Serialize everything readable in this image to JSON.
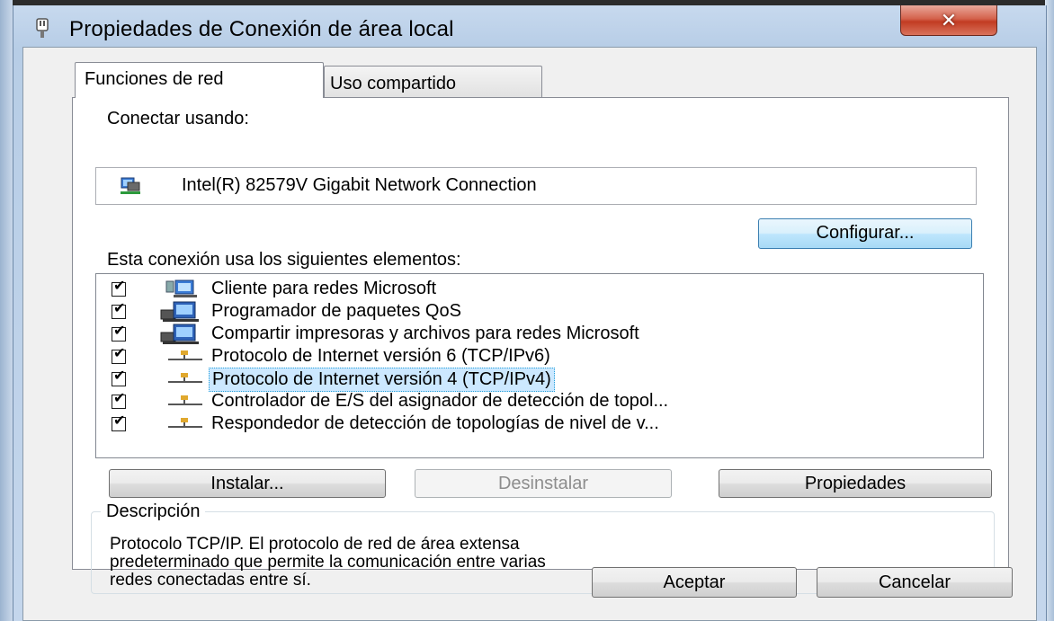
{
  "window": {
    "title": "Propiedades de Conexión de área local",
    "close_label": "✕"
  },
  "tabs": [
    {
      "label": "Funciones de red",
      "active": true
    },
    {
      "label": "Uso compartido",
      "active": false
    }
  ],
  "connect": {
    "label": "Conectar usando:",
    "adapter": "Intel(R) 82579V Gigabit Network Connection",
    "adapter_icon": "network-adapter-icon",
    "configure_label": "Configurar..."
  },
  "components": {
    "label": "Esta conexión usa los siguientes elementos:",
    "items": [
      {
        "label": "Cliente para redes Microsoft",
        "checked": true,
        "icon": "network-client-icon"
      },
      {
        "label": "Programador de paquetes QoS",
        "checked": true,
        "icon": "network-service-icon"
      },
      {
        "label": "Compartir impresoras y archivos para redes Microsoft",
        "checked": true,
        "icon": "network-service-icon"
      },
      {
        "label": "Protocolo de Internet versión 6 (TCP/IPv6)",
        "checked": true,
        "icon": "network-protocol-icon"
      },
      {
        "label": "Protocolo de Internet versión 4 (TCP/IPv4)",
        "checked": true,
        "icon": "network-protocol-icon",
        "selected": true
      },
      {
        "label": "Controlador de E/S del asignador de detección de topol...",
        "checked": true,
        "icon": "network-protocol-icon"
      },
      {
        "label": "Respondedor de detección de topologías de nivel de v...",
        "checked": true,
        "icon": "network-protocol-icon"
      }
    ]
  },
  "actions": {
    "install": "Instalar...",
    "uninstall": "Desinstalar",
    "properties": "Propiedades"
  },
  "description": {
    "legend": "Descripción",
    "line1": "Protocolo TCP/IP. El protocolo de red de área extensa",
    "line2": "predeterminado que permite la comunicación entre varias",
    "line3": "redes conectadas entre sí."
  },
  "footer": {
    "ok": "Aceptar",
    "cancel": "Cancelar"
  },
  "colors": {
    "selection": "#cce8ff",
    "close_button": "#c23b22",
    "titlebar": "#b7cde6"
  }
}
